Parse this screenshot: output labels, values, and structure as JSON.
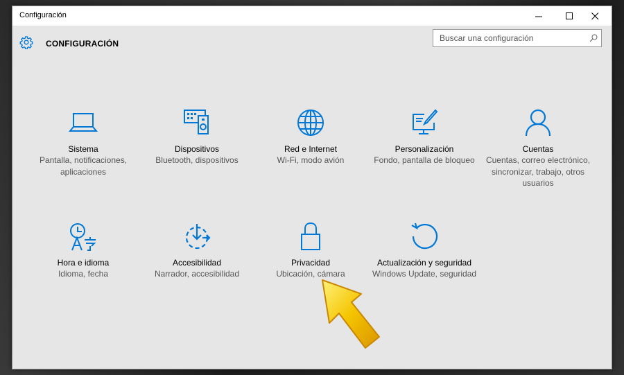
{
  "window": {
    "title": "Configuración"
  },
  "header": {
    "title": "CONFIGURACIÓN"
  },
  "search": {
    "placeholder": "Buscar una configuración"
  },
  "tiles": [
    {
      "title": "Sistema",
      "desc": "Pantalla, notificaciones, aplicaciones"
    },
    {
      "title": "Dispositivos",
      "desc": "Bluetooth, dispositivos"
    },
    {
      "title": "Red e Internet",
      "desc": "Wi-Fi, modo avión"
    },
    {
      "title": "Personalización",
      "desc": "Fondo, pantalla de bloqueo"
    },
    {
      "title": "Cuentas",
      "desc": "Cuentas, correo electrónico, sincronizar, trabajo, otros usuarios"
    },
    {
      "title": "Hora e idioma",
      "desc": "Idioma, fecha"
    },
    {
      "title": "Accesibilidad",
      "desc": "Narrador, accesibilidad"
    },
    {
      "title": "Privacidad",
      "desc": "Ubicación, cámara"
    },
    {
      "title": "Actualización y seguridad",
      "desc": "Windows Update, seguridad"
    }
  ],
  "colors": {
    "accent": "#0078d7",
    "arrow": "#f5c400"
  }
}
